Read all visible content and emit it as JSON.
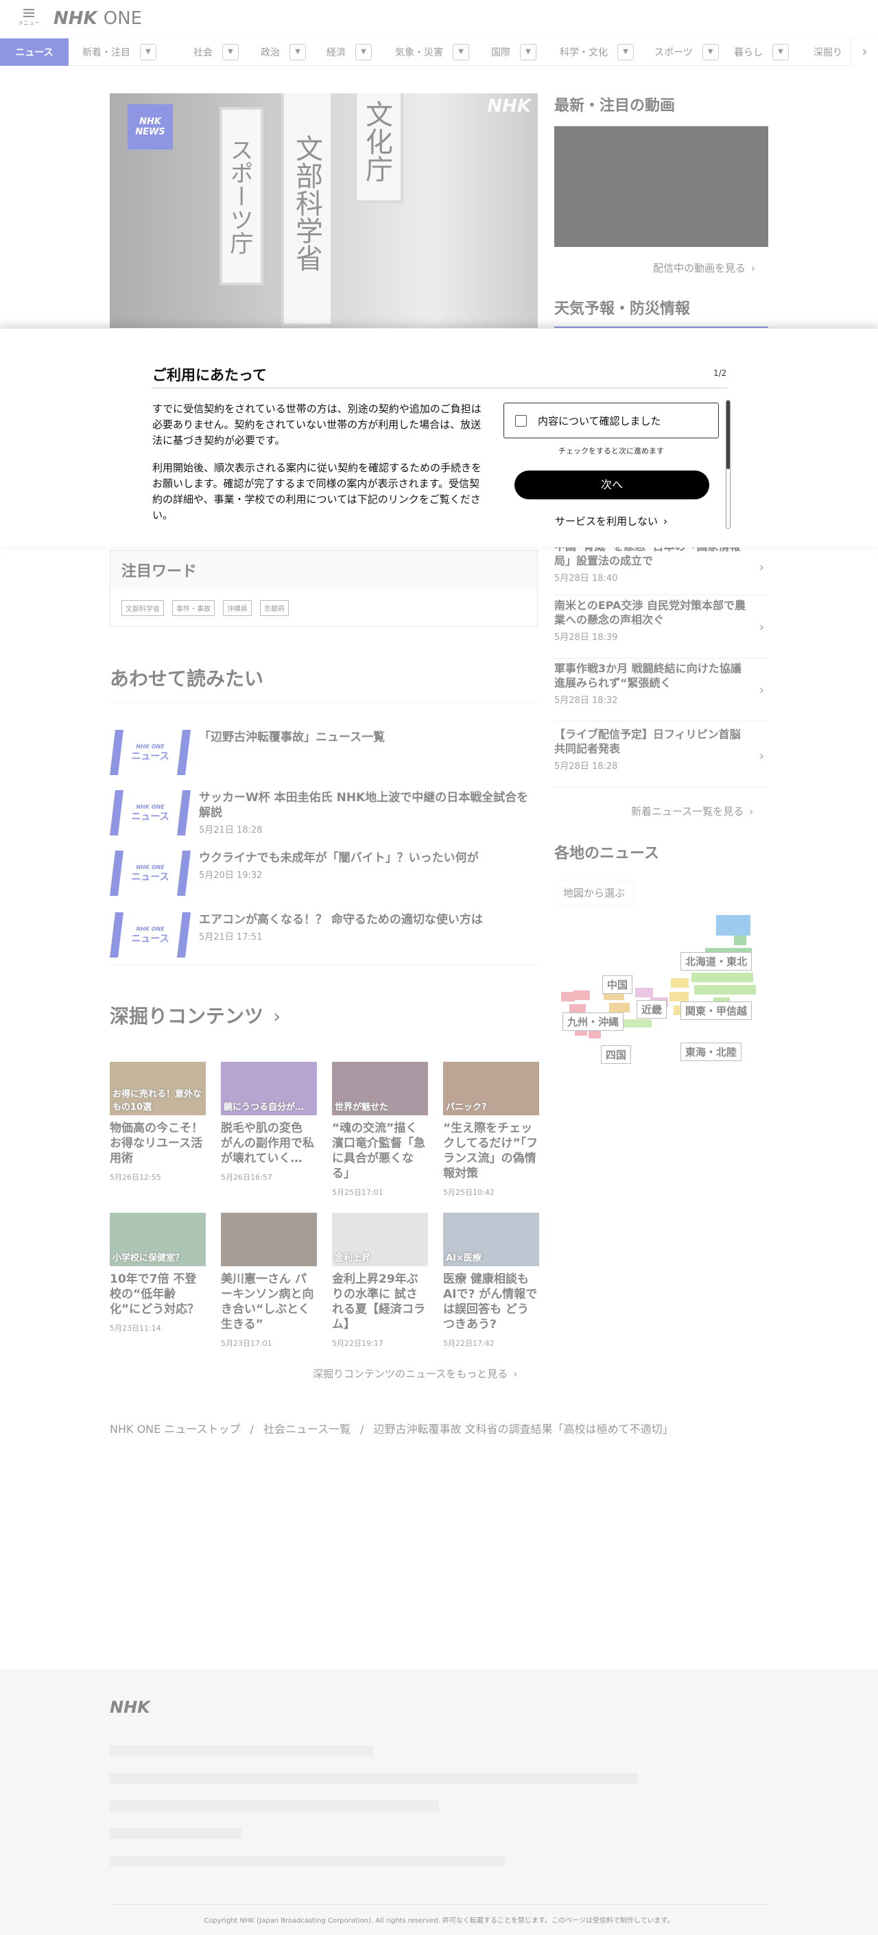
{
  "header": {
    "menu_label": "メニュー",
    "logo_nhk": "NHK",
    "logo_one": "ONE"
  },
  "categories": [
    {
      "label": "ニュース",
      "active": true,
      "dropdown": false
    },
    {
      "label": "新着・注目",
      "dropdown": true
    },
    {
      "label": "社会",
      "dropdown": true
    },
    {
      "label": "政治",
      "dropdown": true
    },
    {
      "label": "経済",
      "dropdown": true
    },
    {
      "label": "気象・災害",
      "dropdown": true
    },
    {
      "label": "国際",
      "dropdown": true
    },
    {
      "label": "科学・文化",
      "dropdown": true
    },
    {
      "label": "スポーツ",
      "dropdown": true
    },
    {
      "label": "暮らし",
      "dropdown": true
    },
    {
      "label": "深掘り",
      "dropdown": true
    }
  ],
  "hero": {
    "badge": "NHK NEWS",
    "sign_left": "スポーツ庁",
    "sign_mid": "文部科学省",
    "sign_right": "文化庁",
    "watermark": "NHK"
  },
  "side": {
    "videos_heading": "最新・注目の動画",
    "videos_more": "配信中の動画を見る",
    "weather_heading": "天気予報・防災情報",
    "news_items": [
      {
        "title": "中国“脅威”を懸念“日本の「国家情報局」設置法の成立で",
        "date": "5月28日 18:40"
      },
      {
        "title": "南米とのEPA交渉 自民党対策本部で農業への懸念の声相次ぐ",
        "date": "5月28日 18:39"
      },
      {
        "title": "軍事作戦3か月 戦闘終結に向けた協議進展みられず“緊張続く",
        "date": "5月28日 18:32"
      },
      {
        "title": "【ライブ配信予定】日フィリピン首脳共同記者発表",
        "date": "5月28日 18:28"
      }
    ],
    "news_more": "新着ニュース一覧を見る",
    "regional_heading": "各地のニュース",
    "map_button": "地図から選ぶ",
    "regions": [
      "北海道・東北",
      "中国",
      "近畿",
      "関東・甲信越",
      "九州・沖縄",
      "四国",
      "東海・北陸"
    ]
  },
  "modal": {
    "title": "ご利用にあたって",
    "page": "1/2",
    "paragraph1": "すでに受信契約をされている世帯の方は、別途の契約や追加のご負担は必要ありません。契約をされていない世帯の方が利用した場合は、放送法に基づき契約が必要です。",
    "paragraph2": "利用開始後、順次表示される案内に従い契約を確認するための手続きをお願いします。確認が完了するまで同様の案内が表示されます。受信契約の詳細や、事業・学校での利用については下記のリンクをご覧ください。",
    "checkbox_label": "内容について確認しました",
    "check_hint": "チェックをすると次に進めます",
    "next_button": "次へ",
    "decline": "サービスを利用しない"
  },
  "trend_words": {
    "heading": "注目ワード",
    "tags": [
      "文部科学省",
      "事件・事故",
      "沖縄県",
      "京都府"
    ]
  },
  "related": {
    "heading": "あわせて読みたい",
    "thumb_brand": "NHK ONE",
    "thumb_label": "ニュース",
    "items": [
      {
        "title": "「辺野古沖転覆事故」ニュース一覧",
        "date": ""
      },
      {
        "title": "サッカーW杯 本田圭佑氏 NHK地上波で中継の日本戦全試合を解説",
        "date": "5月21日 18:28"
      },
      {
        "title": "ウクライナでも未成年が「闇バイト」？いったい何が",
        "date": "5月20日 19:32"
      },
      {
        "title": "エアコンが高くなる！？ 命守るための適切な使い方は",
        "date": "5月21日 17:51"
      }
    ]
  },
  "deep": {
    "heading": "深掘りコンテンツ",
    "items": [
      {
        "title": "物価高の今こそ！お得なリユース活用術",
        "date": "5月26日12:55",
        "caption": "お得に売れる！意外なもの10選",
        "color": "#8a6a3a"
      },
      {
        "title": "脱毛や肌の変色 がんの副作用で私が壊れていく…",
        "date": "5月26日16:57",
        "caption": "鏡にうつる自分が…",
        "color": "#6b4aa0"
      },
      {
        "title": "“魂の交流”描く 濱口竜介監督「急に具合が悪くなる」",
        "date": "5月25日17:01",
        "caption": "世界が魅せた",
        "color": "#553344"
      },
      {
        "title": "“生え際をチェックしてるだけ”「フランス流」の偽情報対策",
        "date": "5月25日10:42",
        "caption": "パニック?",
        "color": "#7a4a2a"
      },
      {
        "title": "10年で7倍 不登校の“低年齢化”にどう対応？",
        "date": "5月23日11:14",
        "caption": "小学校に保健室？",
        "color": "#5a8a6a"
      },
      {
        "title": "美川憲一さん パーキンソン病と向き合い“しぶとく生きる”",
        "date": "5月23日17:01",
        "caption": "",
        "color": "#4a3a2a"
      },
      {
        "title": "金利上昇29年ぶりの水準に 試される夏【経済コラム】",
        "date": "5月22日19:17",
        "caption": "金利上昇",
        "color": "#c9c9c9"
      },
      {
        "title": "医療 健康相談も AIで? がん情報では誤回答も どうつきあう?",
        "date": "5月22日17:42",
        "caption": "AI×医療",
        "color": "#7a8aa0"
      }
    ],
    "more": "深掘りコンテンツのニュースをもっと見る"
  },
  "breadcrumb": [
    "NHK ONE ニューストップ",
    "社会ニュース一覧",
    "辺野古沖転覆事故 文科省の調査結果「高校は極めて不適切」"
  ],
  "footer": {
    "logo": "NHK",
    "copyright": "Copyright NHK (Japan Broadcasting Corporation). All rights reserved. 許可なく転載することを禁じます。このページは受信料で制作しています。"
  }
}
